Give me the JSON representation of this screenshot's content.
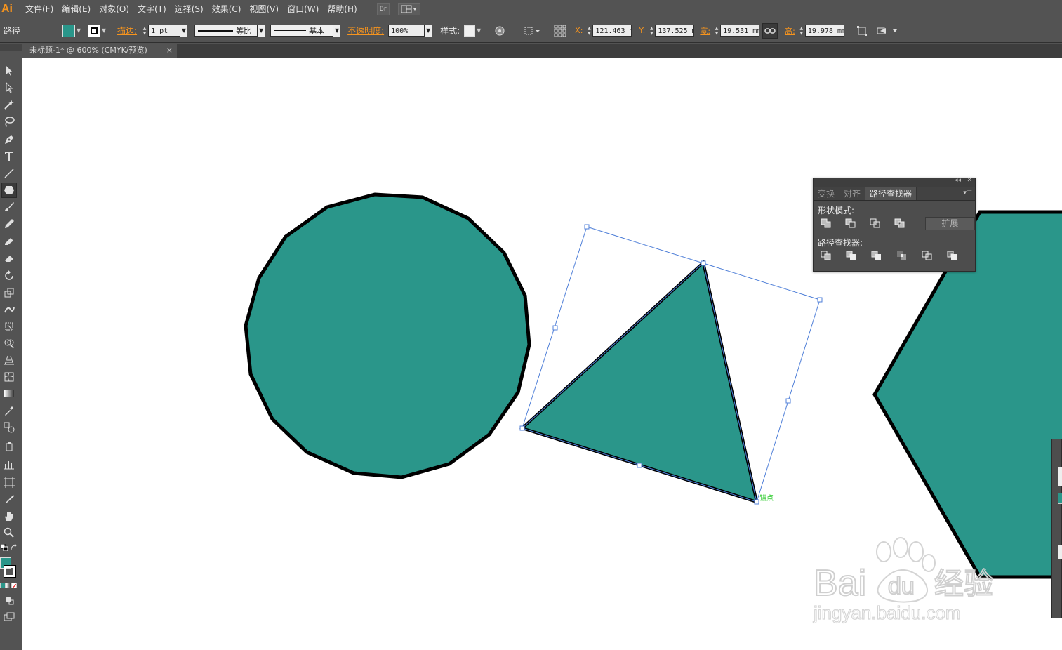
{
  "app": {
    "logo_text": "Ai",
    "menus": [
      "文件(F)",
      "编辑(E)",
      "对象(O)",
      "文字(T)",
      "选择(S)",
      "效果(C)",
      "视图(V)",
      "窗口(W)",
      "帮助(H)"
    ],
    "bridge_label": "Br"
  },
  "controlbar": {
    "selection_type": "路径",
    "stroke_label": "描边:",
    "stroke_weight": "1 pt",
    "stroke_profile": "等比",
    "brush_label": "基本",
    "opacity_label": "不透明度:",
    "opacity_value": "100%",
    "style_label": "样式:",
    "x_label": "X:",
    "x_value": "121.463 m",
    "y_label": "Y:",
    "y_value": "137.525 m",
    "w_label": "宽:",
    "w_value": "19.531 mm",
    "h_label": "高:",
    "h_value": "19.978 mm"
  },
  "document": {
    "tab_title": "未标题-1* @ 600% (CMYK/预览)",
    "close_glyph": "×"
  },
  "canvas": {
    "anchor_hint": "锚点"
  },
  "pathfinder_panel": {
    "tabs": [
      "变换",
      "对齐",
      "路径查找器"
    ],
    "active_tab": 2,
    "shape_modes_label": "形状模式:",
    "expand_label": "扩展",
    "pathfinders_label": "路径查找器:"
  },
  "watermark": {
    "brand": "Bai",
    "brand2": "du",
    "cn": "经验",
    "url": "jingyan.baidu.com"
  },
  "colors": {
    "fill": "#2a968a",
    "stroke": "#000000",
    "ui_bg": "#535353",
    "accent": "#f7941d"
  }
}
